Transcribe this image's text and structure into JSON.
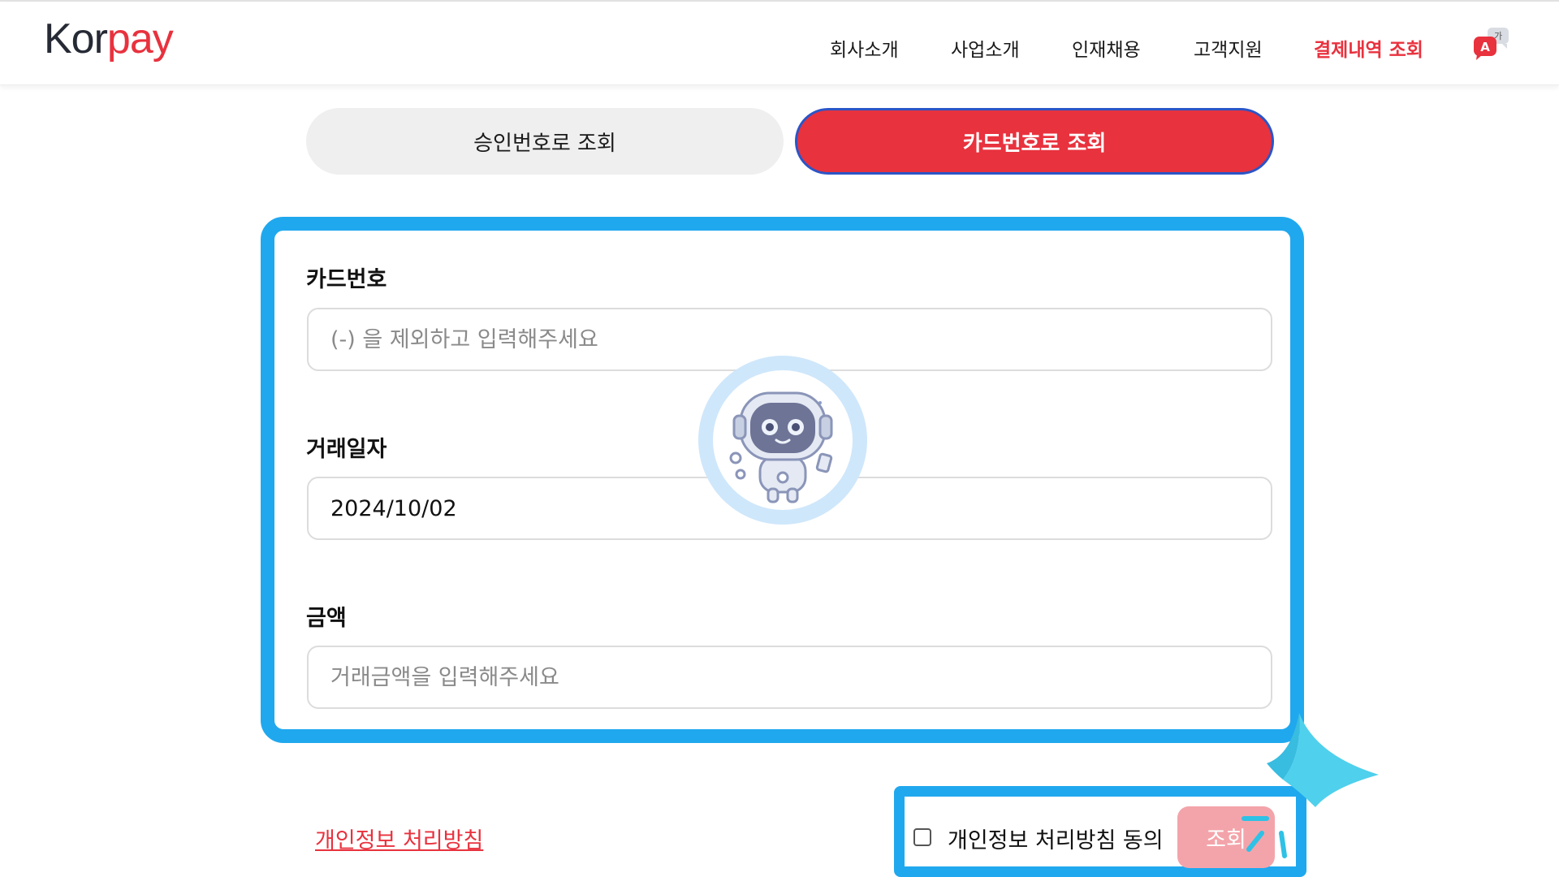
{
  "header": {
    "logo_part1": "Kor",
    "logo_part2": "pay",
    "nav": [
      {
        "label": "회사소개"
      },
      {
        "label": "사업소개"
      },
      {
        "label": "인재채용"
      },
      {
        "label": "고객지원"
      },
      {
        "label": "결제내역 조회",
        "active": true
      }
    ],
    "language_badge": "가",
    "language_icon": "translate-icon"
  },
  "tabs": [
    {
      "label": "승인번호로 조회",
      "selected": false
    },
    {
      "label": "카드번호로 조회",
      "selected": true
    }
  ],
  "form": {
    "card_number": {
      "label": "카드번호",
      "value": "",
      "placeholder": "(-) 을 제외하고 입력해주세요"
    },
    "date": {
      "label": "거래일자",
      "value": "2024/10/02"
    },
    "amount": {
      "label": "금액",
      "value": "",
      "placeholder": "거래금액을 입력해주세요"
    }
  },
  "footer": {
    "policy_link": "개인정보 처리방침",
    "agree_label": "개인정보 처리방침 동의",
    "agree_checked": false,
    "search_button": "조회"
  },
  "colors": {
    "brand_red": "#e8323e",
    "highlight_blue": "#20a8ee",
    "button_disabled_pink": "#f3a4aa"
  }
}
